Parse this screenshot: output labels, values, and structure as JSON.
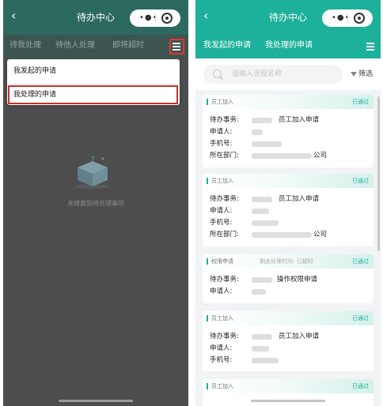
{
  "colors": {
    "left_header": "#2c6a60",
    "left_tabbar": "#3d5550",
    "left_overlay": "#4d4d4d",
    "brand": "#1db09a",
    "highlight": "#e13636"
  },
  "nav": {
    "back_icon": "‹",
    "title": "待办中心",
    "more_icon": "•●•",
    "record_icon": "record-icon"
  },
  "left": {
    "tabs": [
      "待我处理",
      "待他人处理",
      "即将超时"
    ],
    "menu_icon": "menu-icon",
    "dropdown": [
      "我发起的申请",
      "我处理的申请"
    ],
    "empty_text": "未搜索到待处理事项"
  },
  "right": {
    "tabs": [
      "我发起的申请",
      "我处理的申请"
    ],
    "menu_icon": "menu-icon",
    "search_placeholder": "请输入流程名称",
    "filter_label": "筛选",
    "cards": [
      {
        "type": "员工加入",
        "time": "",
        "status": "已通过",
        "rows": [
          {
            "label": "待办事务:",
            "value": "员工加入申请"
          },
          {
            "label": "申请人:",
            "value": ""
          },
          {
            "label": "手机号:",
            "value": ""
          },
          {
            "label": "所在部门:",
            "value": "公司"
          }
        ]
      },
      {
        "type": "员工加入",
        "time": "",
        "status": "已通过",
        "rows": [
          {
            "label": "待办事务:",
            "value": "员工加入申请"
          },
          {
            "label": "申请人:",
            "value": ""
          },
          {
            "label": "手机号:",
            "value": ""
          },
          {
            "label": "所在部门:",
            "value": "公司"
          }
        ]
      },
      {
        "type": "权限申请",
        "time": "剩余处理时间: 已超时",
        "status": "已通过",
        "rows": [
          {
            "label": "待办事务:",
            "value": "操作权限申请"
          },
          {
            "label": "申请人:",
            "value": ""
          }
        ]
      },
      {
        "type": "员工加入",
        "time": "",
        "status": "已通过",
        "rows": [
          {
            "label": "待办事务:",
            "value": "员工加入申请"
          },
          {
            "label": "申请人:",
            "value": ""
          },
          {
            "label": "手机号:",
            "value": ""
          }
        ]
      },
      {
        "type": "员工加入",
        "time": "",
        "status": "已通过",
        "rows": []
      }
    ]
  }
}
